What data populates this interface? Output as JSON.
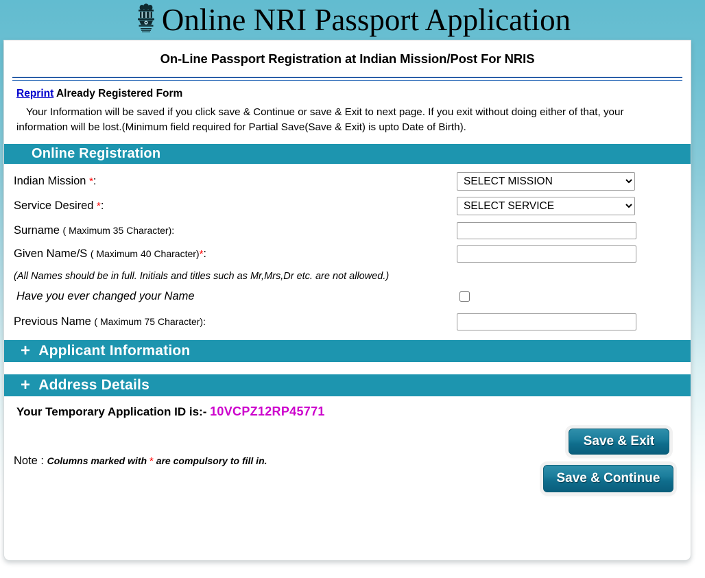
{
  "header": {
    "title": "Online NRI Passport Application",
    "emblem_name": "india-state-emblem-icon"
  },
  "card": {
    "subtitle": "On-Line Passport Registration at Indian Mission/Post For NRIS",
    "reprint_link": "Reprint",
    "reprint_suffix": " Already Registered Form",
    "notice": "Your Information will be saved if you click save & Continue or save & Exit to next page. If you exit without  doing either of that, your information will be lost.(Minimum field required for Partial Save(Save & Exit) is upto  Date of Birth)."
  },
  "sections": {
    "online_registration": "Online Registration",
    "applicant_information": "Applicant Information",
    "address_details": "Address Details",
    "expand_icon": "+"
  },
  "form": {
    "indian_mission": {
      "label": "Indian Mission ",
      "required_mark": "*",
      "colon": ":",
      "value": "SELECT MISSION",
      "options": [
        "SELECT MISSION"
      ]
    },
    "service_desired": {
      "label": "Service Desired ",
      "required_mark": "*",
      "colon": ":",
      "value": "SELECT SERVICE",
      "options": [
        "SELECT SERVICE"
      ]
    },
    "surname": {
      "label": "Surname ",
      "hint": "( Maximum 35 Character):",
      "value": "",
      "placeholder": ""
    },
    "given_name": {
      "label": "Given Name/S ",
      "hint": "( Maximum 40 Character)",
      "required_mark": "*",
      "colon": ":",
      "value": "",
      "placeholder": ""
    },
    "names_note": "(All Names should be in full. Initials and titles such as Mr,Mrs,Dr etc. are not allowed.)",
    "changed_name": {
      "label": "Have you ever changed your Name",
      "checked": false
    },
    "previous_name": {
      "label": "Previous Name ",
      "hint": "( Maximum 75 Character):",
      "value": "",
      "placeholder": ""
    }
  },
  "temp_id": {
    "label": "Your Temporary Application ID is:- ",
    "value": "10VCPZ12RP45771",
    "color": "#cc00cc"
  },
  "footer": {
    "note_prefix": "Note : ",
    "note_body_before": "Columns marked with ",
    "note_star": "*",
    "note_body_after": " are compulsory to fill in.",
    "save_exit": "Save & Exit",
    "save_continue": "Save & Continue"
  },
  "colors": {
    "teal_bar": "#1d95af",
    "background_top": "#62bcd0",
    "link": "#0000cc",
    "required": "#ff0000"
  }
}
